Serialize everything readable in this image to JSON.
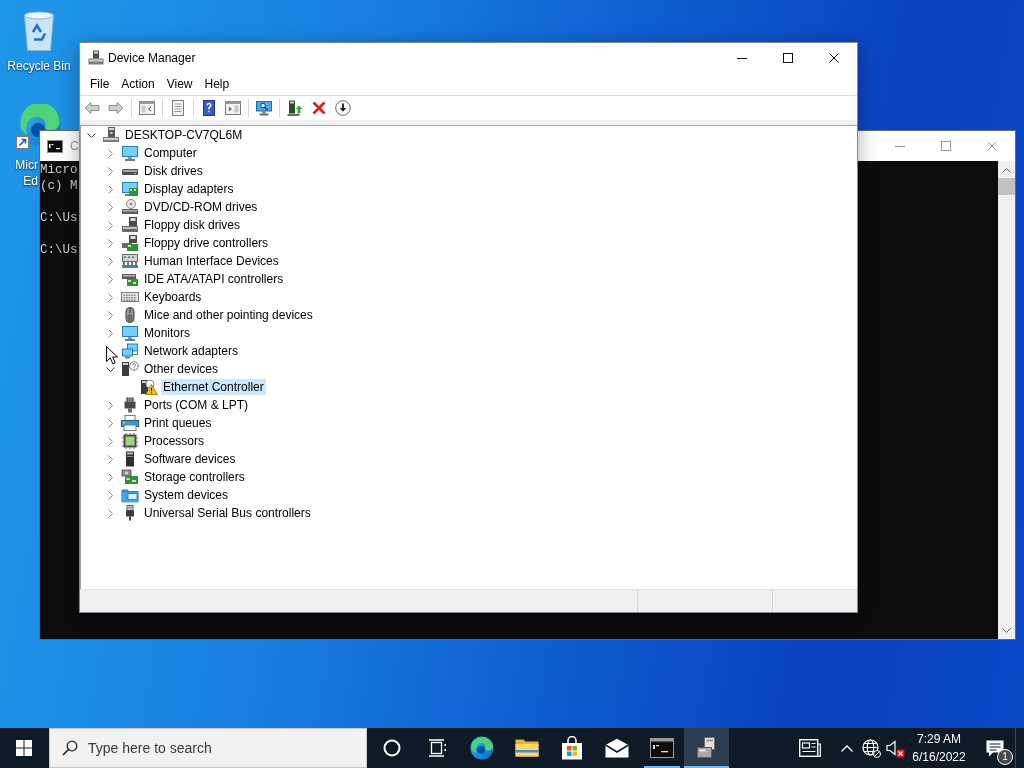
{
  "desktop": {
    "icons": [
      {
        "kind": "recycle-bin",
        "label": [
          "Recycle Bin"
        ]
      },
      {
        "kind": "edge-shortcut",
        "label": [
          "Micr",
          "Ed"
        ]
      }
    ]
  },
  "console_window": {
    "title": "C",
    "active": false,
    "blocks": [
      [
        "Micro",
        "(c) M"
      ],
      [
        "C:\\Us"
      ],
      [
        "C:\\Us"
      ]
    ]
  },
  "device_manager": {
    "title": "Device Manager",
    "active": true,
    "menu": [
      "File",
      "Action",
      "View",
      "Help"
    ],
    "toolbar": [
      {
        "buttons": [
          {
            "kind": "back",
            "disabled": true
          },
          {
            "kind": "forward",
            "disabled": true
          }
        ]
      },
      {
        "buttons": [
          {
            "kind": "console-tree",
            "disabled": false
          }
        ]
      },
      {
        "buttons": [
          {
            "kind": "properties",
            "disabled": false
          }
        ]
      },
      {
        "buttons": [
          {
            "kind": "help",
            "disabled": false
          },
          {
            "kind": "action-pane",
            "disabled": false
          }
        ]
      },
      {
        "buttons": [
          {
            "kind": "scan",
            "disabled": false
          }
        ]
      },
      {
        "buttons": [
          {
            "kind": "update-driver",
            "disabled": false
          },
          {
            "kind": "uninstall",
            "disabled": false
          },
          {
            "kind": "disable",
            "disabled": false
          }
        ]
      }
    ],
    "tree": {
      "label": "DESKTOP-CV7QL6M",
      "kind": "desktop",
      "expanded": true,
      "selected": false,
      "children": [
        {
          "label": "Computer",
          "kind": "computer",
          "expanded": false,
          "selected": false
        },
        {
          "label": "Disk drives",
          "kind": "disk",
          "expanded": false,
          "selected": false
        },
        {
          "label": "Display adapters",
          "kind": "display",
          "expanded": false,
          "selected": false
        },
        {
          "label": "DVD/CD-ROM drives",
          "kind": "dvd",
          "expanded": false,
          "selected": false
        },
        {
          "label": "Floppy disk drives",
          "kind": "floppy",
          "expanded": false,
          "selected": false
        },
        {
          "label": "Floppy drive controllers",
          "kind": "floppy-controller",
          "expanded": false,
          "selected": false
        },
        {
          "label": "Human Interface Devices",
          "kind": "hid",
          "expanded": false,
          "selected": false
        },
        {
          "label": "IDE ATA/ATAPI controllers",
          "kind": "ide",
          "expanded": false,
          "selected": false
        },
        {
          "label": "Keyboards",
          "kind": "keyboard",
          "expanded": false,
          "selected": false
        },
        {
          "label": "Mice and other pointing devices",
          "kind": "mouse",
          "expanded": false,
          "selected": false
        },
        {
          "label": "Monitors",
          "kind": "monitor",
          "expanded": false,
          "selected": false
        },
        {
          "label": "Network adapters",
          "kind": "network",
          "selected": false
        },
        {
          "label": "Other devices",
          "kind": "other",
          "expanded": true,
          "selected": false,
          "children": [
            {
              "label": "Ethernet Controller",
              "kind": "warning",
              "selected": true
            }
          ]
        },
        {
          "label": "Ports (COM & LPT)",
          "kind": "ports",
          "expanded": false,
          "selected": false
        },
        {
          "label": "Print queues",
          "kind": "printer",
          "expanded": false,
          "selected": false
        },
        {
          "label": "Processors",
          "kind": "processor",
          "expanded": false,
          "selected": false
        },
        {
          "label": "Software devices",
          "kind": "software",
          "expanded": false,
          "selected": false
        },
        {
          "label": "Storage controllers",
          "kind": "storage",
          "expanded": false,
          "selected": false
        },
        {
          "label": "System devices",
          "kind": "system",
          "expanded": false,
          "selected": false
        },
        {
          "label": "Universal Serial Bus controllers",
          "kind": "usb",
          "expanded": false,
          "selected": false
        }
      ]
    }
  },
  "taskbar": {
    "search": {
      "placeholder": "Type here to search"
    },
    "apps": [
      {
        "kind": "cortana",
        "running": false,
        "selected": false
      },
      {
        "kind": "task-view",
        "running": false,
        "selected": false
      },
      {
        "kind": "edge",
        "running": false,
        "selected": false
      },
      {
        "kind": "file-explorer",
        "running": false,
        "selected": false
      },
      {
        "kind": "store",
        "running": false,
        "selected": false
      },
      {
        "kind": "mail",
        "running": false,
        "selected": false
      },
      {
        "kind": "command-prompt",
        "running": true,
        "selected": false
      },
      {
        "kind": "device-manager",
        "running": true,
        "selected": true
      }
    ],
    "tray": [
      {
        "kind": "news"
      },
      {
        "kind": "overflow"
      },
      {
        "kind": "network"
      },
      {
        "kind": "volume-muted"
      }
    ],
    "clock": {
      "time": "7:29 AM",
      "date": "6/16/2022"
    },
    "notifications": {
      "count": "1"
    }
  }
}
